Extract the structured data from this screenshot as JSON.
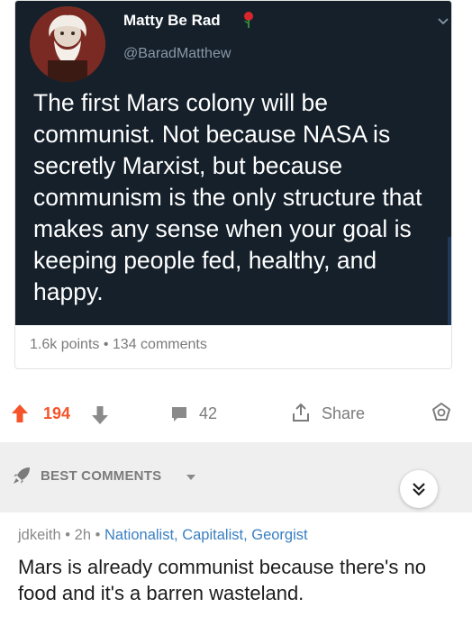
{
  "post": {
    "tweet": {
      "author_name": "Matty Be Rad",
      "author_handle": "@BaradMatthew",
      "text": "The first Mars colony will be communist. Not because NASA is secretly Marxist, but because communism is the only structure that makes any sense when your goal is keeping people fed, healthy, and happy.",
      "name_icon": "rose-icon",
      "menu_icon": "chevron-down-icon"
    },
    "points": "1.6k points",
    "separator": "•",
    "comments": "134 comments"
  },
  "actions": {
    "upvote_icon": "upvote-arrow-icon",
    "vote_count": "194",
    "downvote_icon": "downvote-arrow-icon",
    "comments_icon": "comment-bubble-icon",
    "comments_count": "42",
    "share_icon": "share-icon",
    "share_label": "Share",
    "award_icon": "award-icon"
  },
  "comments_header": {
    "sort_icon": "rocket-icon",
    "sort_label": "BEST COMMENTS",
    "collapse_icon": "double-chevron-down-icon"
  },
  "comment": {
    "username": "jdkeith",
    "separator": "•",
    "age": "2h",
    "flair": "Nationalist, Capitalist, Georgist",
    "body": "Mars is already communist because there's no food and it's a barren wasteland."
  },
  "colors": {
    "tweet_background": "#15202b",
    "upvote": "#f5542a",
    "flair": "#3a7fc1",
    "meta_gray": "#7b7b7b"
  }
}
